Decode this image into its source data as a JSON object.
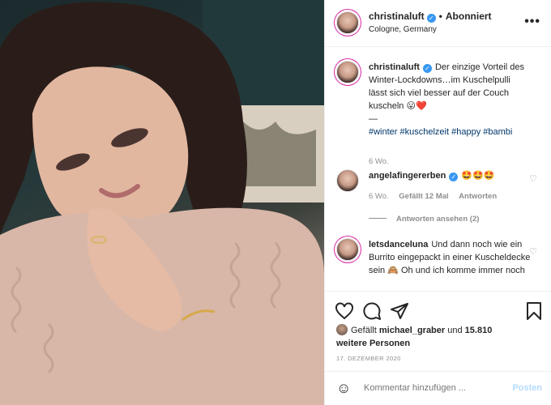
{
  "header": {
    "username": "christinaluft",
    "follow_status": "Abonniert",
    "separator": "•",
    "location": "Cologne, Germany",
    "more_label": "•••"
  },
  "caption": {
    "username": "christinaluft",
    "text": "Der einzige Vorteil des Winter-Lockdowns…im Kuschelpulli lässt sich viel besser auf der Couch kuscheln 😛❤️",
    "dash": "—",
    "hashtags": "#winter #kuschelzeit #happy #bambi",
    "time": "6 Wo."
  },
  "comments": [
    {
      "username": "angelafingererben",
      "text": "🤩🤩🤩",
      "time": "6 Wo.",
      "likes": "Gefällt 12 Mal",
      "reply": "Antworten",
      "view_replies": "Antworten ansehen (2)"
    },
    {
      "username": "letsdanceluna",
      "text": "Und dann noch wie ein Burrito eingepackt in einer Kuscheldecke sein 🙈 Oh und ich komme immer noch"
    }
  ],
  "likes": {
    "prefix": "Gefällt",
    "user": "michael_graber",
    "conj": "und",
    "others": "15.810 weitere Personen"
  },
  "date": "17. DEZEMBER 2020",
  "add_comment": {
    "placeholder": "Kommentar hinzufügen ...",
    "post_label": "Posten"
  },
  "icons": [
    "heart-icon",
    "comment-icon",
    "share-icon",
    "bookmark-icon",
    "emoji-icon",
    "verified-icon",
    "more-icon"
  ],
  "colors": {
    "accent": "#3897f0",
    "post_disabled": "#b3dbff",
    "hashtag": "#00376b",
    "muted": "#8e8e8e"
  }
}
